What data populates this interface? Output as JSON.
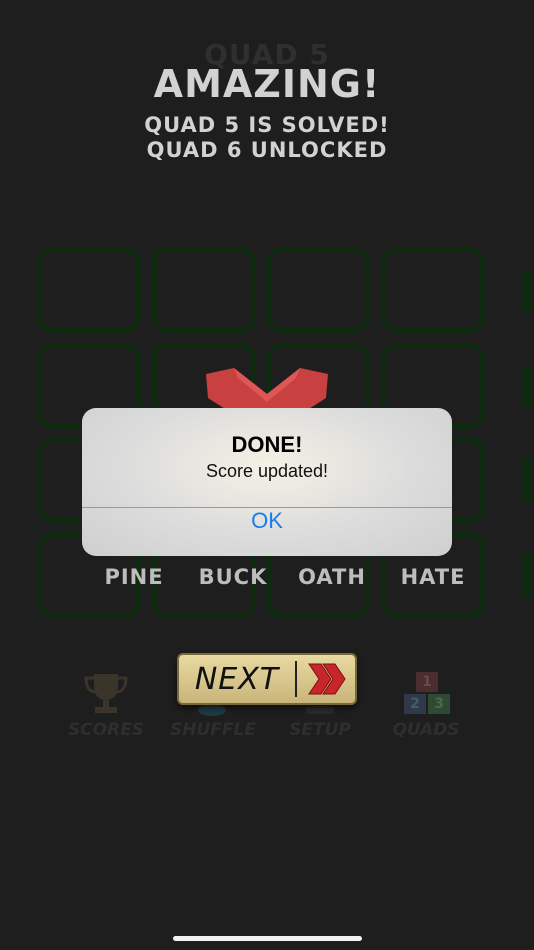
{
  "header": {
    "quad_title": "QUAD 5",
    "headline": "AMAZING!",
    "status_line1": "QUAD 5 IS SOLVED!",
    "status_line2": "QUAD 6 UNLOCKED"
  },
  "words": [
    "PINE",
    "BUCK",
    "OATH",
    "HATE"
  ],
  "next_button": {
    "label": "NEXT"
  },
  "nav": [
    {
      "label": "SCORES",
      "icon": "trophy-icon"
    },
    {
      "label": "SHUFFLE",
      "icon": "shuffle-icon"
    },
    {
      "label": "SETUP",
      "icon": "setup-icon"
    },
    {
      "label": "QUADS",
      "icon": "number-blocks-icon"
    }
  ],
  "quads_icon_digits": [
    "1",
    "2",
    "3"
  ],
  "dialog": {
    "title": "DONE!",
    "message": "Score updated!",
    "ok_label": "OK"
  },
  "colors": {
    "background": "#1e1e1e",
    "grid_border": "#0f2b0f",
    "ok_blue": "#1a7cf5",
    "next_arrow_red": "#c8262a"
  }
}
